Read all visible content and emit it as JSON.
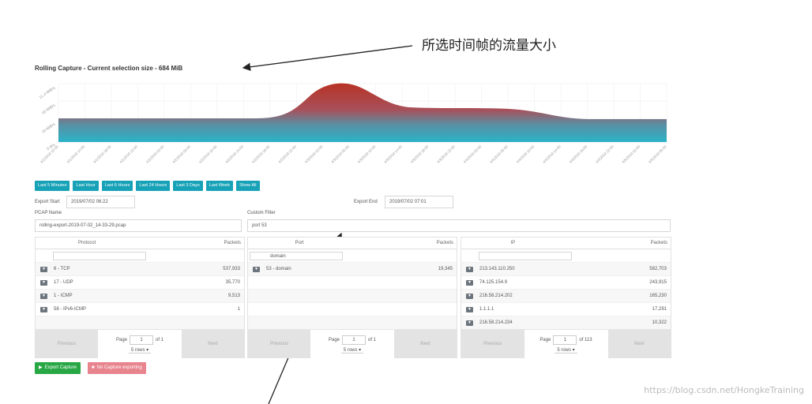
{
  "annotation": "所选时间帧的流量大小",
  "chart_title": "Rolling Capture - Current selection size - 684 MiB",
  "chart": {
    "y_ticks": [
      "11.4 MiB/s",
      "16 MiB/s",
      "19 MiB/s",
      "0 B/s"
    ],
    "x_ticks": [
      "4/1/2019 10:00",
      "4/1/2019 14:00",
      "4/1/2019 18:00",
      "4/1/2019 22:00",
      "4/2/2019 02:00",
      "4/2/2019 06:00",
      "4/2/2019 10:00",
      "4/2/2019 14:00",
      "4/2/2019 18:00",
      "4/2/2019 22:00",
      "4/3/2019 02:00",
      "4/3/2019 06:00",
      "4/3/2019 10:00",
      "4/3/2019 14:00",
      "4/3/2019 18:00",
      "4/3/2019 22:00",
      "4/4/2019 02:00",
      "4/4/2019 06:00",
      "4/4/2019 10:00",
      "4/4/2019 14:00",
      "4/4/2019 18:00",
      "4/4/2019 22:00",
      "4/5/2019 02:00",
      "4/5/2019 06:00"
    ],
    "top_color": "#b83225",
    "bottom_color": "#2ab3c8"
  },
  "time_buttons": [
    "Last 5 Minutes",
    "Last Hour",
    "Last 6 Hours",
    "Last 24 Hours",
    "Last 3 Days",
    "Last Week",
    "Show All"
  ],
  "export_start": {
    "label": "Export Start",
    "value": "2019/07/02 06:22"
  },
  "export_end": {
    "label": "Export End",
    "value": "2019/07/02 07:01"
  },
  "pcap_name": {
    "label": "PCAP Name",
    "value": "rolling-export-2019-07-02_14-33-29.pcap"
  },
  "custom_filter": {
    "label": "Custom Filter",
    "value": "port 53"
  },
  "protocol_table": {
    "col1": "Protocol",
    "col2": "Packets",
    "filter": "",
    "rows": [
      {
        "name": "6 - TCP",
        "value": "537,933"
      },
      {
        "name": "17 - UDP",
        "value": "35,770"
      },
      {
        "name": "1 - ICMP",
        "value": "9,513"
      },
      {
        "name": "58 - IPv6-ICMP",
        "value": "1"
      }
    ],
    "page": "1",
    "of": "of 1",
    "rows_select": "5 rows"
  },
  "port_table": {
    "col1": "Port",
    "col2": "Packets",
    "filter": "domain",
    "rows": [
      {
        "name": "53 - domain",
        "value": "19,345"
      }
    ],
    "page": "1",
    "of": "of 1",
    "rows_select": "5 rows"
  },
  "ip_table": {
    "col1": "IP",
    "col2": "Packets",
    "filter": "",
    "rows": [
      {
        "name": "213.143.110.250",
        "value": "582,703"
      },
      {
        "name": "74.125.154.9",
        "value": "243,915"
      },
      {
        "name": "216.58.214.202",
        "value": "165,230"
      },
      {
        "name": "1.1.1.1",
        "value": "17,291"
      },
      {
        "name": "216.58.214.234",
        "value": "10,322"
      }
    ],
    "page": "1",
    "of": "of 113",
    "rows_select": "5 rows"
  },
  "pager": {
    "previous": "Previous",
    "next": "Next",
    "page_label": "Page"
  },
  "export_capture": "Export Capture",
  "no_capture": "No Capture exporting",
  "watermark": "https://blog.csdn.net/HongkeTraining",
  "colors": {
    "accent": "#17a2b8",
    "export": "#28a745",
    "danger": "#e8848e"
  }
}
